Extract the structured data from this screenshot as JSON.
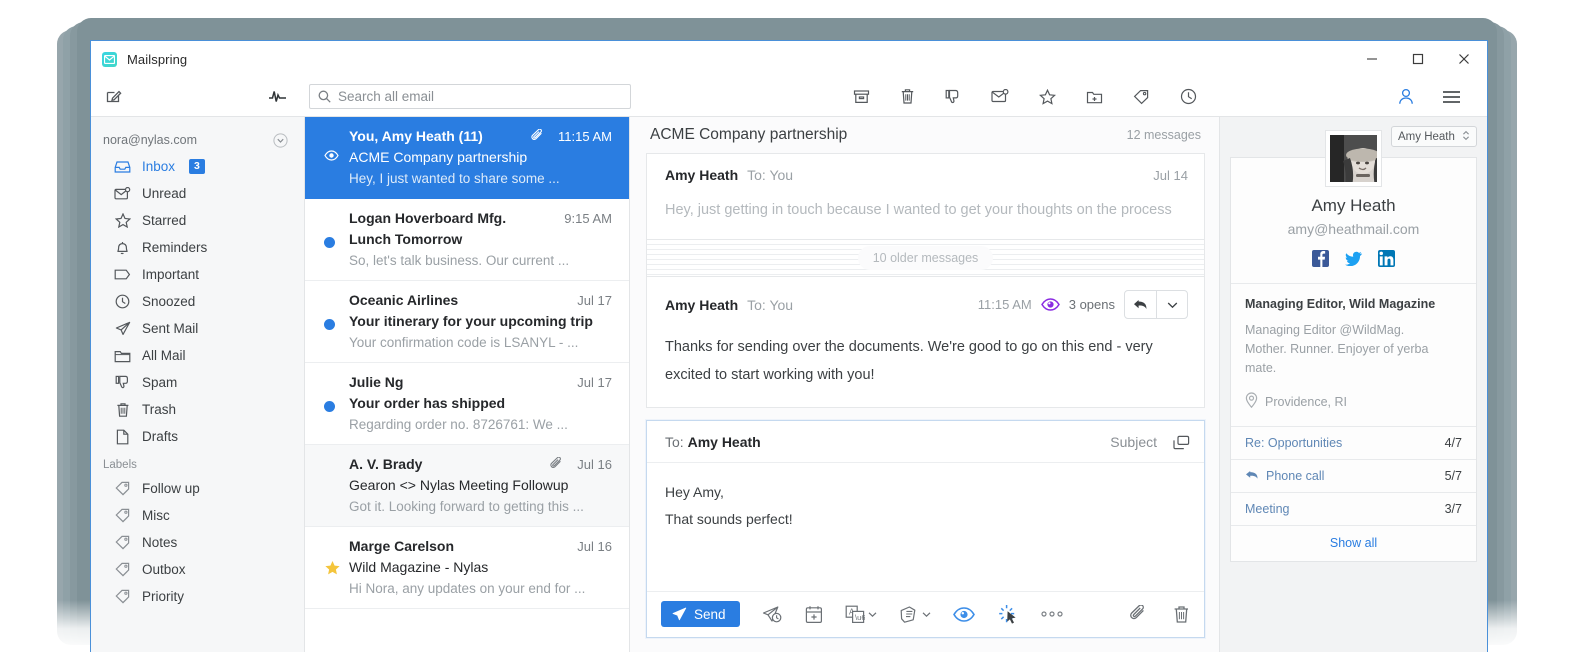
{
  "window": {
    "app_name": "Mailspring",
    "app_icon": "envelope-icon",
    "minimize": "−",
    "maximize": "□",
    "close": "×"
  },
  "toolbar": {
    "compose_icon": "compose-icon",
    "activity_icon": "activity-pulse-icon",
    "search_placeholder": "Search all email",
    "search_value": "",
    "actions": [
      {
        "name": "archive-icon",
        "label": "Archive"
      },
      {
        "name": "trash-icon",
        "label": "Trash"
      },
      {
        "name": "spam-icon",
        "label": "Mark as spam"
      },
      {
        "name": "mark-unread-icon",
        "label": "Mark as unread"
      },
      {
        "name": "star-icon",
        "label": "Star"
      },
      {
        "name": "move-to-folder-icon",
        "label": "Move to folder"
      },
      {
        "name": "tag-icon",
        "label": "Apply label"
      },
      {
        "name": "snooze-icon",
        "label": "Snooze"
      }
    ],
    "account_icon": "person-icon",
    "menu_icon": "hamburger-menu-icon"
  },
  "sidebar": {
    "account": "nora@nylas.com",
    "account_chevron": "chevron-down-circle-icon",
    "items": [
      {
        "label": "Inbox",
        "icon": "inbox-icon",
        "badge": "3",
        "active": true
      },
      {
        "label": "Unread",
        "icon": "unread-envelope-icon",
        "badge": "",
        "active": false
      },
      {
        "label": "Starred",
        "icon": "star-icon",
        "badge": "",
        "active": false
      },
      {
        "label": "Reminders",
        "icon": "bell-icon",
        "badge": "",
        "active": false
      },
      {
        "label": "Important",
        "icon": "important-tag-icon",
        "badge": "",
        "active": false
      },
      {
        "label": "Snoozed",
        "icon": "clock-icon",
        "badge": "",
        "active": false
      },
      {
        "label": "Sent Mail",
        "icon": "paper-plane-icon",
        "badge": "",
        "active": false
      },
      {
        "label": "All Mail",
        "icon": "folder-icon",
        "badge": "",
        "active": false
      },
      {
        "label": "Spam",
        "icon": "thumbs-down-icon",
        "badge": "",
        "active": false
      },
      {
        "label": "Trash",
        "icon": "trash-icon",
        "badge": "",
        "active": false
      },
      {
        "label": "Drafts",
        "icon": "document-icon",
        "badge": "",
        "active": false
      }
    ],
    "labels_heading": "Labels",
    "labels": [
      {
        "label": "Follow up",
        "icon": "tag-icon"
      },
      {
        "label": "Misc",
        "icon": "tag-icon"
      },
      {
        "label": "Notes",
        "icon": "tag-icon"
      },
      {
        "label": "Outbox",
        "icon": "tag-icon"
      },
      {
        "label": "Priority",
        "icon": "tag-icon"
      }
    ]
  },
  "list": {
    "rows": [
      {
        "from": "You, Amy Heath (11)",
        "date": "11:15 AM",
        "subject": "ACME Company partnership",
        "snippet": "Hey, I just wanted to share some ...",
        "selected": true,
        "attachment": true,
        "marker": "eye",
        "alt": false
      },
      {
        "from": "Logan Hoverboard Mfg.",
        "date": "9:15 AM",
        "subject": "Lunch Tomorrow",
        "snippet": "So, let's talk business. Our current ...",
        "selected": false,
        "attachment": false,
        "marker": "dot",
        "alt": false
      },
      {
        "from": "Oceanic Airlines",
        "date": "Jul 17",
        "subject": "Your itinerary for your upcoming trip",
        "snippet": "Your confirmation code is LSANYL - ...",
        "selected": false,
        "attachment": false,
        "marker": "dot",
        "alt": false
      },
      {
        "from": "Julie Ng",
        "date": "Jul 17",
        "subject": "Your order has shipped",
        "snippet": "Regarding order no. 8726761: We ...",
        "selected": false,
        "attachment": false,
        "marker": "dot",
        "alt": false
      },
      {
        "from": "A. V. Brady",
        "date": "Jul 16",
        "subject": "Gearon <> Nylas Meeting Followup",
        "snippet": "Got it. Looking forward to getting this ...",
        "selected": false,
        "attachment": true,
        "marker": "none",
        "alt": true
      },
      {
        "from": "Marge Carelson",
        "date": "Jul 16",
        "subject": "Wild Magazine - Nylas",
        "snippet": "Hi Nora, any updates on your end for ...",
        "selected": false,
        "attachment": false,
        "marker": "star",
        "alt": false
      }
    ]
  },
  "thread": {
    "title": "ACME Company partnership",
    "message_count": "12 messages",
    "collapsed_label": "10 older messages",
    "messages": [
      {
        "from": "Amy Heath",
        "to": "To: You",
        "date": "Jul 14",
        "body": "Hey, just getting in touch because I wanted to get your thoughts on the process",
        "collapsed": true,
        "opens": ""
      },
      {
        "from": "Amy Heath",
        "to": "To: You",
        "date": "11:15 AM",
        "body": "Thanks for sending over the documents. We're good to go on this end - very excited to start working with you!",
        "collapsed": false,
        "opens": "3 opens"
      }
    ],
    "reply_icon": "reply-arrow-icon",
    "reply_menu_icon": "chevron-down-icon"
  },
  "compose": {
    "to_prefix": "To:",
    "to_value": "Amy Heath",
    "subject_label": "Subject",
    "popout_icon": "popout-window-icon",
    "body_lines": [
      "Hey Amy,",
      "That sounds perfect!"
    ],
    "send_label": "Send",
    "send_icon": "paper-plane-icon",
    "tools": [
      {
        "name": "send-later-icon",
        "caret": false,
        "blue": false
      },
      {
        "name": "calendar-availability-icon",
        "caret": false,
        "blue": false
      },
      {
        "name": "translate-icon",
        "caret": true,
        "blue": false
      },
      {
        "name": "template-icon",
        "caret": true,
        "blue": false
      },
      {
        "name": "read-receipts-icon",
        "caret": false,
        "blue": true
      },
      {
        "name": "link-tracking-icon",
        "caret": false,
        "blue": true
      }
    ],
    "more_label": "● ● ●",
    "attach_icon": "paperclip-icon",
    "discard_icon": "trash-icon"
  },
  "contact": {
    "selector_value": "Amy Heath",
    "selector_icon": "updown-chevron-icon",
    "avatar": "contact-photo",
    "name": "Amy Heath",
    "email": "amy@heathmail.com",
    "social": [
      {
        "name": "facebook-icon",
        "color": "#3b5998",
        "glyph": "f"
      },
      {
        "name": "twitter-icon",
        "color": "#1da1f2",
        "glyph": "t"
      },
      {
        "name": "linkedin-icon",
        "color": "#0077b5",
        "glyph": "in"
      }
    ],
    "role": "Managing Editor, Wild Magazine",
    "bio_line1": "Managing Editor @WildMag.",
    "bio_line2": "Mother. Runner. Enjoyer of yerba mate.",
    "location_icon": "map-pin-icon",
    "location": "Providence, RI",
    "threads": [
      {
        "label": "Re: Opportunities",
        "value": "4/7",
        "icon": ""
      },
      {
        "label": "Phone call",
        "value": "5/7",
        "icon": "reply-arrow-icon"
      },
      {
        "label": "Meeting",
        "value": "3/7",
        "icon": ""
      }
    ],
    "show_all": "Show all"
  },
  "colors": {
    "accent": "#2a7de1",
    "selected_row": "#2a7de1",
    "badge": "#2a7de1",
    "star": "#f4c53c",
    "open_tracker": "#8a2be2",
    "window_border": "#4a90d9"
  }
}
